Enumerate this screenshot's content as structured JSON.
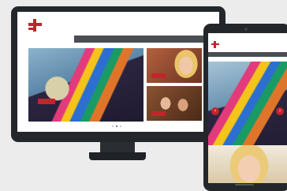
{
  "colors": {
    "accent": "#c2242c",
    "device_frame": "#23272b",
    "nav_bar": "#4a4e52",
    "background": "#ececec"
  },
  "icons": {
    "logo": "plus-cross-logo-icon",
    "prev": "chevron-left-icon",
    "next": "chevron-right-icon"
  },
  "desktop": {
    "brand": "",
    "tagline": "",
    "top_right": "",
    "nav": [
      "",
      "",
      "",
      "",
      "",
      ""
    ],
    "hero": {
      "title": "",
      "button": ""
    },
    "cards": [
      {
        "title": "",
        "button": ""
      },
      {
        "title": "",
        "button": ""
      }
    ],
    "slider_dots": 3,
    "active_dot": 1
  },
  "tablet": {
    "brand": "",
    "hero": {
      "title": "",
      "button": ""
    },
    "prev_arrow": "‹",
    "next_arrow": "›"
  }
}
